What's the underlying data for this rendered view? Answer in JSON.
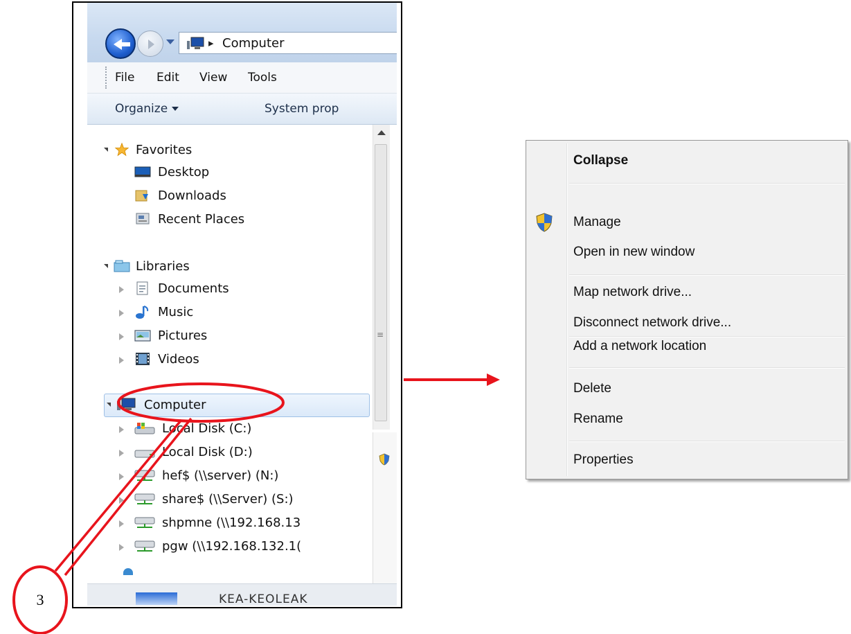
{
  "explorer": {
    "address_location": "Computer",
    "menu": [
      "File",
      "Edit",
      "View",
      "Tools"
    ],
    "commands": {
      "organize": "Organize",
      "system_properties": "System prop"
    },
    "favorites": {
      "label": "Favorites",
      "items": [
        "Desktop",
        "Downloads",
        "Recent Places"
      ]
    },
    "libraries": {
      "label": "Libraries",
      "items": [
        "Documents",
        "Music",
        "Pictures",
        "Videos"
      ]
    },
    "computer": {
      "label": "Computer",
      "items": [
        "Local Disk (C:)",
        "Local Disk (D:)",
        "hef$ (\\\\server) (N:)",
        "share$ (\\\\Server) (S:)",
        "shpmne (\\\\192.168.13",
        "pgw (\\\\192.168.132.1("
      ]
    },
    "bottom_label": "KEA-KEOLEAK"
  },
  "context_menu": {
    "items": [
      "Collapse",
      "Manage",
      "Open in new window",
      "Map network drive...",
      "Disconnect network drive...",
      "Add a network location",
      "Delete",
      "Rename",
      "Properties"
    ]
  },
  "annotation": {
    "step_number": "3"
  },
  "colors": {
    "annotation_red": "#e8141c",
    "selection_blue": "#dbe9f9",
    "menu_bg": "#f1f1f1"
  }
}
